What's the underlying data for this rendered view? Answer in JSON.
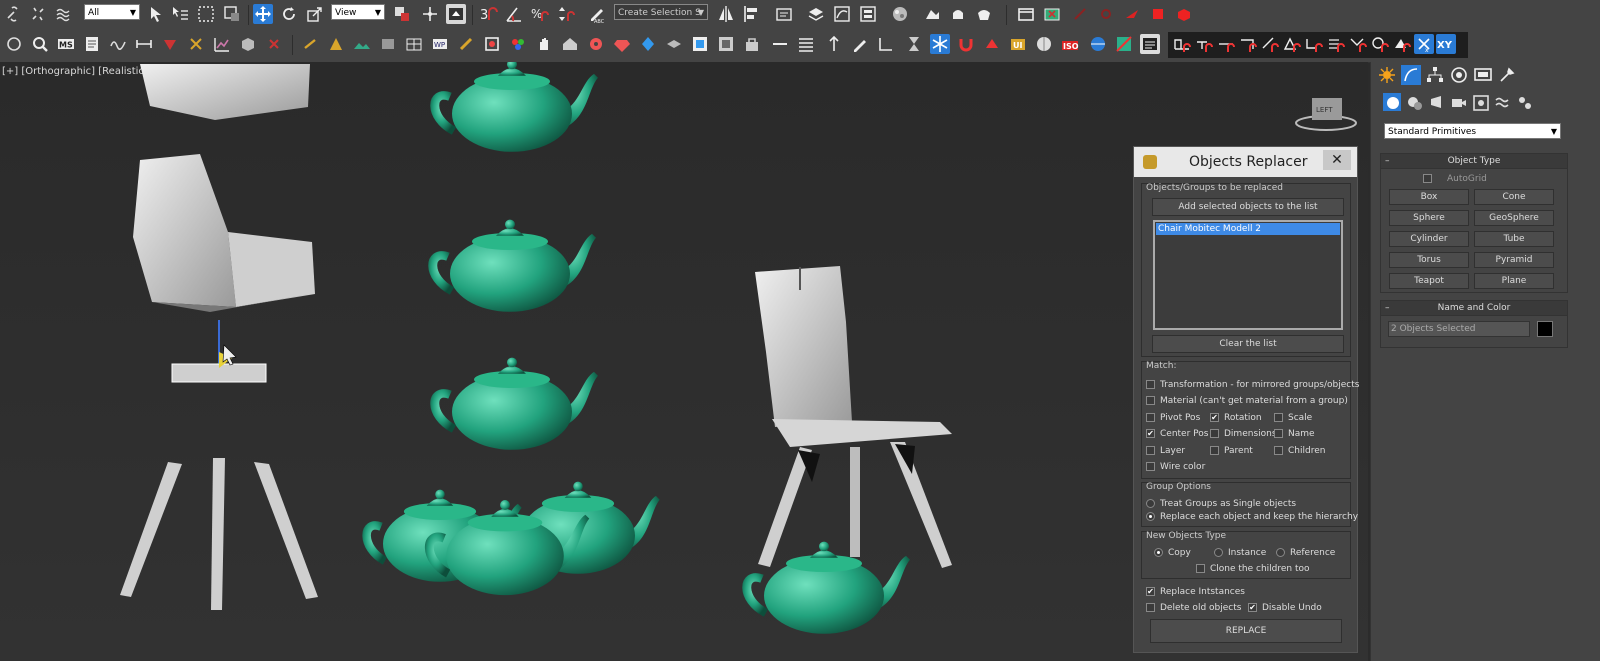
{
  "toolbar1": {
    "selection_filter": "All",
    "reference_coord": "View",
    "named_selection_placeholder": "Create Selection S"
  },
  "viewport": {
    "labels": [
      "[+]",
      "[Orthographic]",
      "[Realistic]"
    ],
    "viewcube_label": "LEFT"
  },
  "dialog": {
    "title": "Objects Replacer",
    "close_label": "✕",
    "group_objects": {
      "label": "Objects/Groups to be replaced",
      "add_button": "Add selected objects to the list",
      "items": [
        "Chair Mobitec Modell 2"
      ],
      "clear_button": "Clear the list"
    },
    "match": {
      "label": "Match:",
      "transformation": {
        "label": "Transformation - for mirrored groups/objects",
        "checked": false
      },
      "material": {
        "label": "Material (can't get material from a group)",
        "checked": false
      },
      "pivot_pos": {
        "label": "Pivot Pos",
        "checked": false
      },
      "rotation": {
        "label": "Rotation",
        "checked": true
      },
      "scale": {
        "label": "Scale",
        "checked": false
      },
      "center_pos": {
        "label": "Center Pos",
        "checked": true
      },
      "dimensions": {
        "label": "Dimensions",
        "checked": false
      },
      "name": {
        "label": "Name",
        "checked": false
      },
      "layer": {
        "label": "Layer",
        "checked": false
      },
      "parent": {
        "label": "Parent",
        "checked": false
      },
      "children": {
        "label": "Children",
        "checked": false
      },
      "wire_color": {
        "label": "Wire color",
        "checked": false
      }
    },
    "group_options": {
      "label": "Group Options",
      "single": {
        "label": "Treat Groups as Single objects",
        "selected": false
      },
      "hierarchy": {
        "label": "Replace each object and keep the hierarchy",
        "selected": true
      }
    },
    "new_type": {
      "label": "New Objects Type",
      "copy": {
        "label": "Copy",
        "selected": true
      },
      "instance": {
        "label": "Instance",
        "selected": false
      },
      "reference": {
        "label": "Reference",
        "selected": false
      },
      "clone_children": {
        "label": "Clone the children too",
        "checked": false
      }
    },
    "replace_instances": {
      "label": "Replace Intstances",
      "checked": true
    },
    "delete_old": {
      "label": "Delete old objects",
      "checked": false
    },
    "disable_undo": {
      "label": "Disable Undo",
      "checked": true
    },
    "replace_button": "REPLACE"
  },
  "command_panel": {
    "category": "Standard Primitives",
    "object_type": {
      "header": "Object Type",
      "autogrid": "AutoGrid",
      "buttons": [
        "Box",
        "Cone",
        "Sphere",
        "GeoSphere",
        "Cylinder",
        "Tube",
        "Torus",
        "Pyramid",
        "Teapot",
        "Plane"
      ]
    },
    "name_color": {
      "header": "Name and Color",
      "name_value": "2 Objects Selected",
      "swatch_color": "#000000"
    }
  },
  "colors": {
    "teapot": "#2bb08a",
    "chair": "#cfcfcf",
    "active_blue": "#2a7bd5"
  }
}
